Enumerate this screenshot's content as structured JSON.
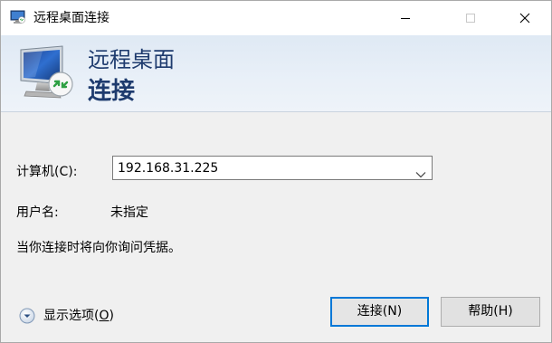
{
  "window": {
    "title": "远程桌面连接",
    "controls": {
      "minimize_icon": "minimize-icon",
      "maximize_icon": "maximize-icon",
      "close_icon": "close-icon"
    }
  },
  "banner": {
    "line1": "远程桌面",
    "line2": "连接",
    "icon": "remote-desktop-monitor-icon"
  },
  "form": {
    "computer_label": "计算机(C):",
    "computer_value": "192.168.31.225",
    "username_label": "用户名:",
    "username_value": "未指定",
    "info_text": "当你连接时将向你询问凭据。"
  },
  "footer": {
    "show_options_prefix": "显示选项(",
    "show_options_key": "O",
    "show_options_suffix": ")",
    "connect_label": "连接(N)",
    "help_label": "帮助(H)"
  },
  "colors": {
    "banner_text": "#1e3b6e",
    "focus_border": "#0078d7",
    "dialog_bg": "#f0f0f0"
  }
}
